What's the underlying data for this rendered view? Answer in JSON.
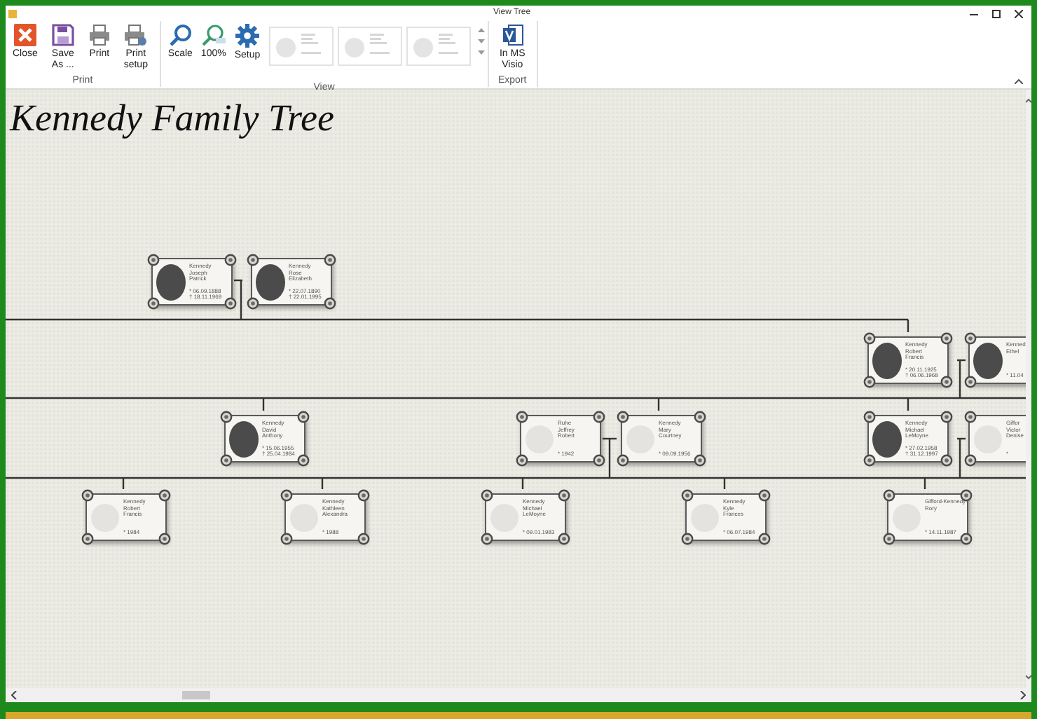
{
  "window": {
    "title": "View Tree"
  },
  "ribbon": {
    "groups": [
      {
        "label": "Print",
        "buttons": [
          {
            "label": "Close",
            "kind": "close"
          },
          {
            "label": "Save As ...",
            "kind": "save"
          },
          {
            "label": "Print",
            "kind": "print"
          },
          {
            "label": "Print setup",
            "kind": "print-setup"
          }
        ]
      },
      {
        "label": "View",
        "buttons": [
          {
            "label": "Scale",
            "kind": "scale"
          },
          {
            "label": "100%",
            "kind": "zoom"
          },
          {
            "label": "Setup",
            "kind": "setup"
          },
          {
            "kind": "gallery"
          }
        ]
      },
      {
        "label": "Export",
        "buttons": [
          {
            "label": "In MS Visio",
            "kind": "visio"
          }
        ]
      }
    ]
  },
  "tree": {
    "title": "Kennedy Family Tree",
    "people": [
      {
        "name_lines": [
          "Kennedy",
          "Joseph",
          "Patrick"
        ],
        "dates": [
          "* 06.09.1888",
          "† 18.11.1969"
        ],
        "photo": true
      },
      {
        "name_lines": [
          "Kennedy",
          "Rose",
          "Elizabeth"
        ],
        "dates": [
          "* 22.07.1890",
          "† 22.01.1995"
        ],
        "photo": true
      },
      {
        "name_lines": [
          "Kennedy",
          "Robert",
          "Francis"
        ],
        "dates": [
          "* 20.11.1925",
          "† 06.06.1968"
        ],
        "photo": true
      },
      {
        "name_lines": [
          "Kenned",
          "Ethel"
        ],
        "dates": [
          "* 11.04"
        ],
        "photo": true
      },
      {
        "name_lines": [
          "Kennedy",
          "David",
          "Anthony"
        ],
        "dates": [
          "* 15.06.1955",
          "† 25.04.1984"
        ],
        "photo": true
      },
      {
        "name_lines": [
          "Ruhe",
          "Jeffrey",
          "Robert"
        ],
        "dates": [
          "* 1942"
        ],
        "photo": false
      },
      {
        "name_lines": [
          "Kennedy",
          "Mary",
          "Courtney"
        ],
        "dates": [
          "* 09.09.1956"
        ],
        "photo": false
      },
      {
        "name_lines": [
          "Kennedy",
          "Michael",
          "LeMoyne"
        ],
        "dates": [
          "* 27.02.1958",
          "† 31.12.1997"
        ],
        "photo": true
      },
      {
        "name_lines": [
          "Giffor",
          "Victor",
          "Denise"
        ],
        "dates": [
          "*"
        ],
        "photo": false
      },
      {
        "name_lines": [
          "Kennedy",
          "Robert",
          "Francis"
        ],
        "dates": [
          "* 1984"
        ],
        "photo": false
      },
      {
        "name_lines": [
          "Kennedy",
          "Kathleen",
          "Alexandra"
        ],
        "dates": [
          "* 1988"
        ],
        "photo": false
      },
      {
        "name_lines": [
          "Kennedy",
          "Michael",
          "LeMoyne"
        ],
        "dates": [
          "* 09.01.1983"
        ],
        "photo": false
      },
      {
        "name_lines": [
          "Kennedy",
          "Kyle",
          "Frances"
        ],
        "dates": [
          "* 06.07.1984"
        ],
        "photo": false
      },
      {
        "name_lines": [
          "Gifford-Kennedy",
          "Rory"
        ],
        "dates": [
          "* 14.11.1987"
        ],
        "photo": false
      }
    ]
  }
}
